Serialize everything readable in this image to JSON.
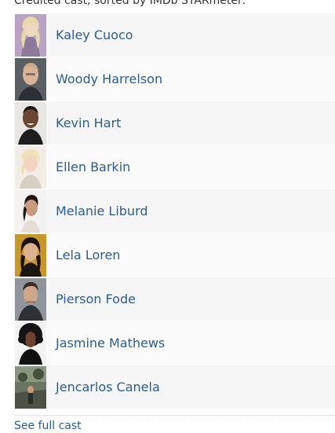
{
  "header": {
    "text": "Credited cast, sorted by IMDb STARmeter:"
  },
  "cast": [
    {
      "name": "Kaley Cuoco"
    },
    {
      "name": "Woody Harrelson"
    },
    {
      "name": "Kevin Hart"
    },
    {
      "name": "Ellen Barkin"
    },
    {
      "name": "Melanie Liburd"
    },
    {
      "name": "Lela Loren"
    },
    {
      "name": "Pierson Fode"
    },
    {
      "name": "Jasmine Mathews"
    },
    {
      "name": "Jencarlos Canela"
    }
  ],
  "footer": {
    "link_text": "See full cast"
  }
}
